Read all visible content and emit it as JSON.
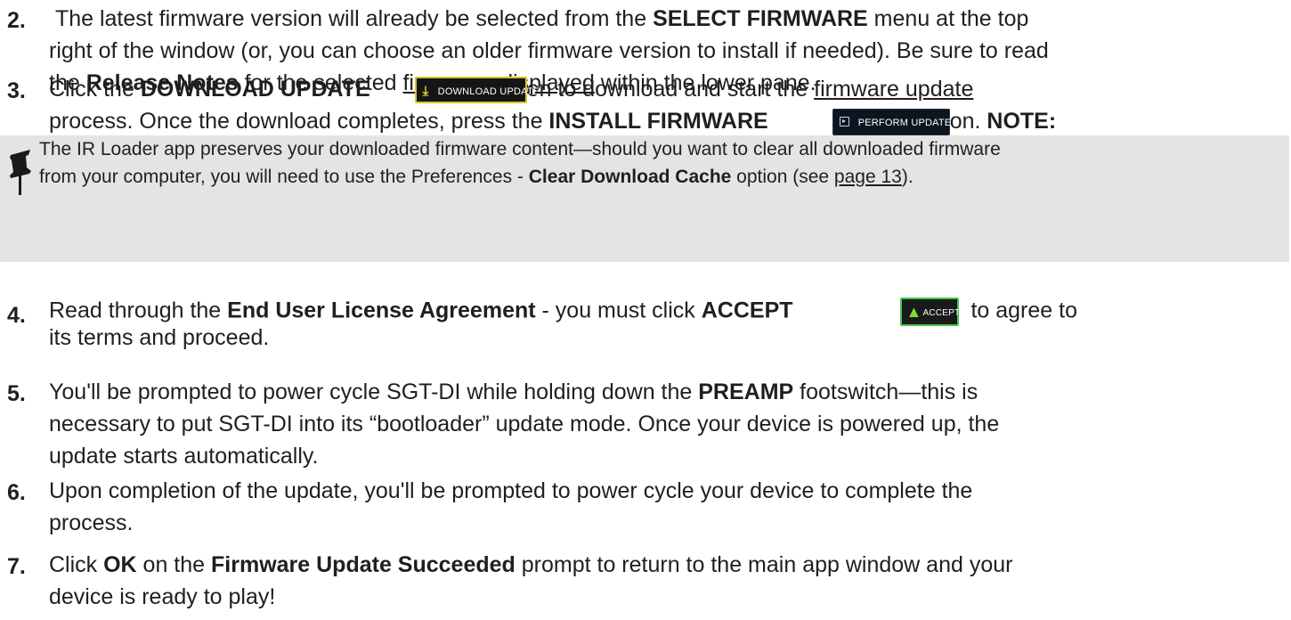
{
  "step2": {
    "number": "2.",
    "t1": "The latest firmware version will already be selected from the ",
    "select_firmware": "SELECT FIRMWARE",
    "t2": " menu at the top",
    "t3": "right of the window (or, you can choose an older firmware version to install if needed). Be sure to read",
    "t4": "the ",
    "release_notes": "Release Notes",
    "t5": " for the selected ",
    "firmware_link": "firmware, displayed",
    "t6": " within the lower pane."
  },
  "step3": {
    "number": "3.",
    "t1": "Click the ",
    "download_update": "DOWNLOAD UPDATE",
    "download_button_label": "DOWNLOAD UPDATE",
    "t2": "on to download and start the ",
    "firmware_update_link": "firmware update",
    "t3": "process. Once the download completes, press the ",
    "install_firmware": "INSTALL FIRMWARE",
    "perform_button_label": "PERFORM UPDATE",
    "t4": "on. ",
    "note_label": "NOTE:"
  },
  "note": {
    "t1": "The IR Loader app preserves your downloaded firmware content—should you want to clear all downloaded firmware",
    "t2": "from your computer, you will need to use the Preferences - ",
    "clear_cache": "Clear Download Cache",
    "t3": " option (see ",
    "page_link": "page 13",
    "t4": ")."
  },
  "step4": {
    "number": "4.",
    "t1": "Read through the ",
    "eula": "End User License Agreement",
    "t2": " - you must click ",
    "accept": "ACCEPT",
    "accept_button_label": "ACCEPT",
    "t3": "to agree to",
    "t4": "its terms and proceed."
  },
  "step5": {
    "number": "5.",
    "t1": "You'll be prompted to power cycle SGT-DI while holding down the ",
    "preamp": "PREAMP",
    "t2": " footswitch—this is",
    "t3": "necessary to put SGT-DI into its “bootloader” update mode. Once your device is powered up, the",
    "t4": "update starts automatically."
  },
  "step6": {
    "number": "6.",
    "t1": "Upon completion of the update, you'll be prompted to power cycle your device to complete the",
    "t2": "process."
  },
  "step7": {
    "number": "7.",
    "t1": "Click ",
    "ok": "OK",
    "t2": " on the ",
    "succeeded": "Firmware Update Succeeded",
    "t3": " prompt to return to the main app window and your",
    "t4": "device is ready to play!"
  },
  "colors": {
    "note_background": "#e4e4e4",
    "download_border": "#d6c62a",
    "accept_border": "#43c24e"
  },
  "icons": {
    "download": "download-icon",
    "perform": "play-box-icon",
    "accept": "thumbs-up-icon",
    "note": "pushpin-icon"
  }
}
